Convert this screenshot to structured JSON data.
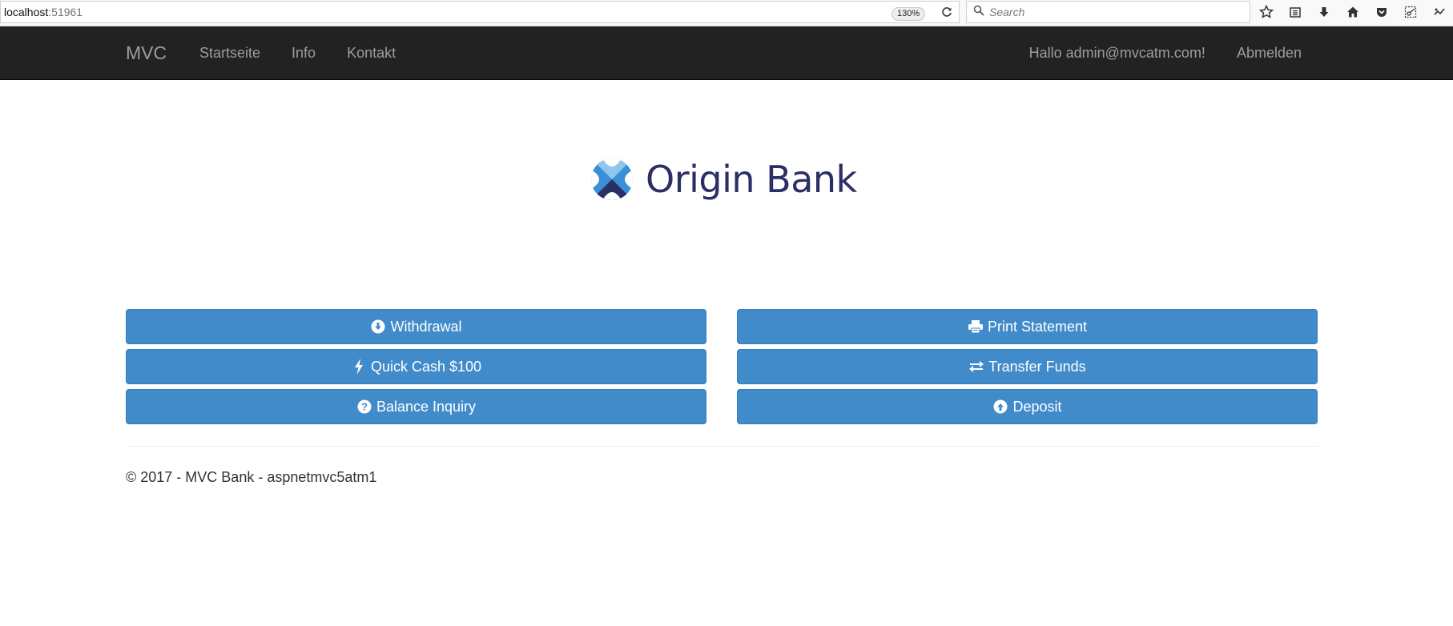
{
  "browser": {
    "url_host": "localhost",
    "url_port": ":51961",
    "zoom": "130%",
    "search_placeholder": "Search",
    "icons": [
      "star-icon",
      "reading-list-icon",
      "download-icon",
      "home-icon",
      "pocket-icon",
      "screenshot-icon",
      "extension-icon"
    ]
  },
  "navbar": {
    "brand": "MVC",
    "links": [
      "Startseite",
      "Info",
      "Kontakt"
    ],
    "greeting": "Hallo admin@mvcatm.com!",
    "logout": "Abmelden",
    "background": "#222222"
  },
  "logo": {
    "text": "Origin Bank",
    "text_color": "#2c2f66",
    "icon_colors": [
      "#2c2f66",
      "#3a8fd6",
      "#8fc6ec"
    ]
  },
  "actions": {
    "withdrawal": "Withdrawal",
    "quick_cash": "Quick Cash $100",
    "balance_inquiry": "Balance Inquiry",
    "print_statement": "Print Statement",
    "transfer_funds": "Transfer Funds",
    "deposit": "Deposit",
    "button_color": "#428bca"
  },
  "footer": {
    "text": "© 2017 - MVC Bank - aspnetmvc5atm1"
  }
}
